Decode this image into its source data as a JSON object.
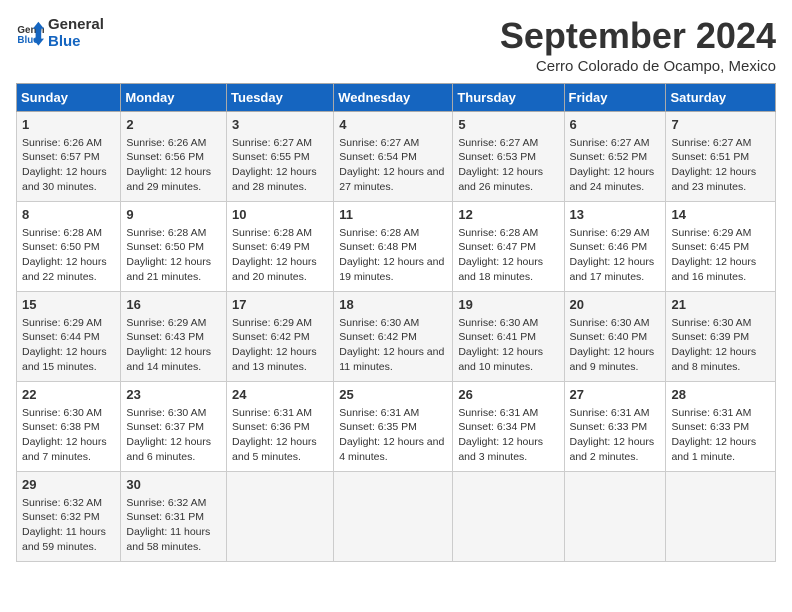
{
  "header": {
    "logo_line1": "General",
    "logo_line2": "Blue",
    "month": "September 2024",
    "location": "Cerro Colorado de Ocampo, Mexico"
  },
  "days_of_week": [
    "Sunday",
    "Monday",
    "Tuesday",
    "Wednesday",
    "Thursday",
    "Friday",
    "Saturday"
  ],
  "weeks": [
    [
      {
        "day": "1",
        "info": "Sunrise: 6:26 AM\nSunset: 6:57 PM\nDaylight: 12 hours and 30 minutes."
      },
      {
        "day": "2",
        "info": "Sunrise: 6:26 AM\nSunset: 6:56 PM\nDaylight: 12 hours and 29 minutes."
      },
      {
        "day": "3",
        "info": "Sunrise: 6:27 AM\nSunset: 6:55 PM\nDaylight: 12 hours and 28 minutes."
      },
      {
        "day": "4",
        "info": "Sunrise: 6:27 AM\nSunset: 6:54 PM\nDaylight: 12 hours and 27 minutes."
      },
      {
        "day": "5",
        "info": "Sunrise: 6:27 AM\nSunset: 6:53 PM\nDaylight: 12 hours and 26 minutes."
      },
      {
        "day": "6",
        "info": "Sunrise: 6:27 AM\nSunset: 6:52 PM\nDaylight: 12 hours and 24 minutes."
      },
      {
        "day": "7",
        "info": "Sunrise: 6:27 AM\nSunset: 6:51 PM\nDaylight: 12 hours and 23 minutes."
      }
    ],
    [
      {
        "day": "8",
        "info": "Sunrise: 6:28 AM\nSunset: 6:50 PM\nDaylight: 12 hours and 22 minutes."
      },
      {
        "day": "9",
        "info": "Sunrise: 6:28 AM\nSunset: 6:50 PM\nDaylight: 12 hours and 21 minutes."
      },
      {
        "day": "10",
        "info": "Sunrise: 6:28 AM\nSunset: 6:49 PM\nDaylight: 12 hours and 20 minutes."
      },
      {
        "day": "11",
        "info": "Sunrise: 6:28 AM\nSunset: 6:48 PM\nDaylight: 12 hours and 19 minutes."
      },
      {
        "day": "12",
        "info": "Sunrise: 6:28 AM\nSunset: 6:47 PM\nDaylight: 12 hours and 18 minutes."
      },
      {
        "day": "13",
        "info": "Sunrise: 6:29 AM\nSunset: 6:46 PM\nDaylight: 12 hours and 17 minutes."
      },
      {
        "day": "14",
        "info": "Sunrise: 6:29 AM\nSunset: 6:45 PM\nDaylight: 12 hours and 16 minutes."
      }
    ],
    [
      {
        "day": "15",
        "info": "Sunrise: 6:29 AM\nSunset: 6:44 PM\nDaylight: 12 hours and 15 minutes."
      },
      {
        "day": "16",
        "info": "Sunrise: 6:29 AM\nSunset: 6:43 PM\nDaylight: 12 hours and 14 minutes."
      },
      {
        "day": "17",
        "info": "Sunrise: 6:29 AM\nSunset: 6:42 PM\nDaylight: 12 hours and 13 minutes."
      },
      {
        "day": "18",
        "info": "Sunrise: 6:30 AM\nSunset: 6:42 PM\nDaylight: 12 hours and 11 minutes."
      },
      {
        "day": "19",
        "info": "Sunrise: 6:30 AM\nSunset: 6:41 PM\nDaylight: 12 hours and 10 minutes."
      },
      {
        "day": "20",
        "info": "Sunrise: 6:30 AM\nSunset: 6:40 PM\nDaylight: 12 hours and 9 minutes."
      },
      {
        "day": "21",
        "info": "Sunrise: 6:30 AM\nSunset: 6:39 PM\nDaylight: 12 hours and 8 minutes."
      }
    ],
    [
      {
        "day": "22",
        "info": "Sunrise: 6:30 AM\nSunset: 6:38 PM\nDaylight: 12 hours and 7 minutes."
      },
      {
        "day": "23",
        "info": "Sunrise: 6:30 AM\nSunset: 6:37 PM\nDaylight: 12 hours and 6 minutes."
      },
      {
        "day": "24",
        "info": "Sunrise: 6:31 AM\nSunset: 6:36 PM\nDaylight: 12 hours and 5 minutes."
      },
      {
        "day": "25",
        "info": "Sunrise: 6:31 AM\nSunset: 6:35 PM\nDaylight: 12 hours and 4 minutes."
      },
      {
        "day": "26",
        "info": "Sunrise: 6:31 AM\nSunset: 6:34 PM\nDaylight: 12 hours and 3 minutes."
      },
      {
        "day": "27",
        "info": "Sunrise: 6:31 AM\nSunset: 6:33 PM\nDaylight: 12 hours and 2 minutes."
      },
      {
        "day": "28",
        "info": "Sunrise: 6:31 AM\nSunset: 6:33 PM\nDaylight: 12 hours and 1 minute."
      }
    ],
    [
      {
        "day": "29",
        "info": "Sunrise: 6:32 AM\nSunset: 6:32 PM\nDaylight: 11 hours and 59 minutes."
      },
      {
        "day": "30",
        "info": "Sunrise: 6:32 AM\nSunset: 6:31 PM\nDaylight: 11 hours and 58 minutes."
      },
      {
        "day": "",
        "info": ""
      },
      {
        "day": "",
        "info": ""
      },
      {
        "day": "",
        "info": ""
      },
      {
        "day": "",
        "info": ""
      },
      {
        "day": "",
        "info": ""
      }
    ]
  ]
}
